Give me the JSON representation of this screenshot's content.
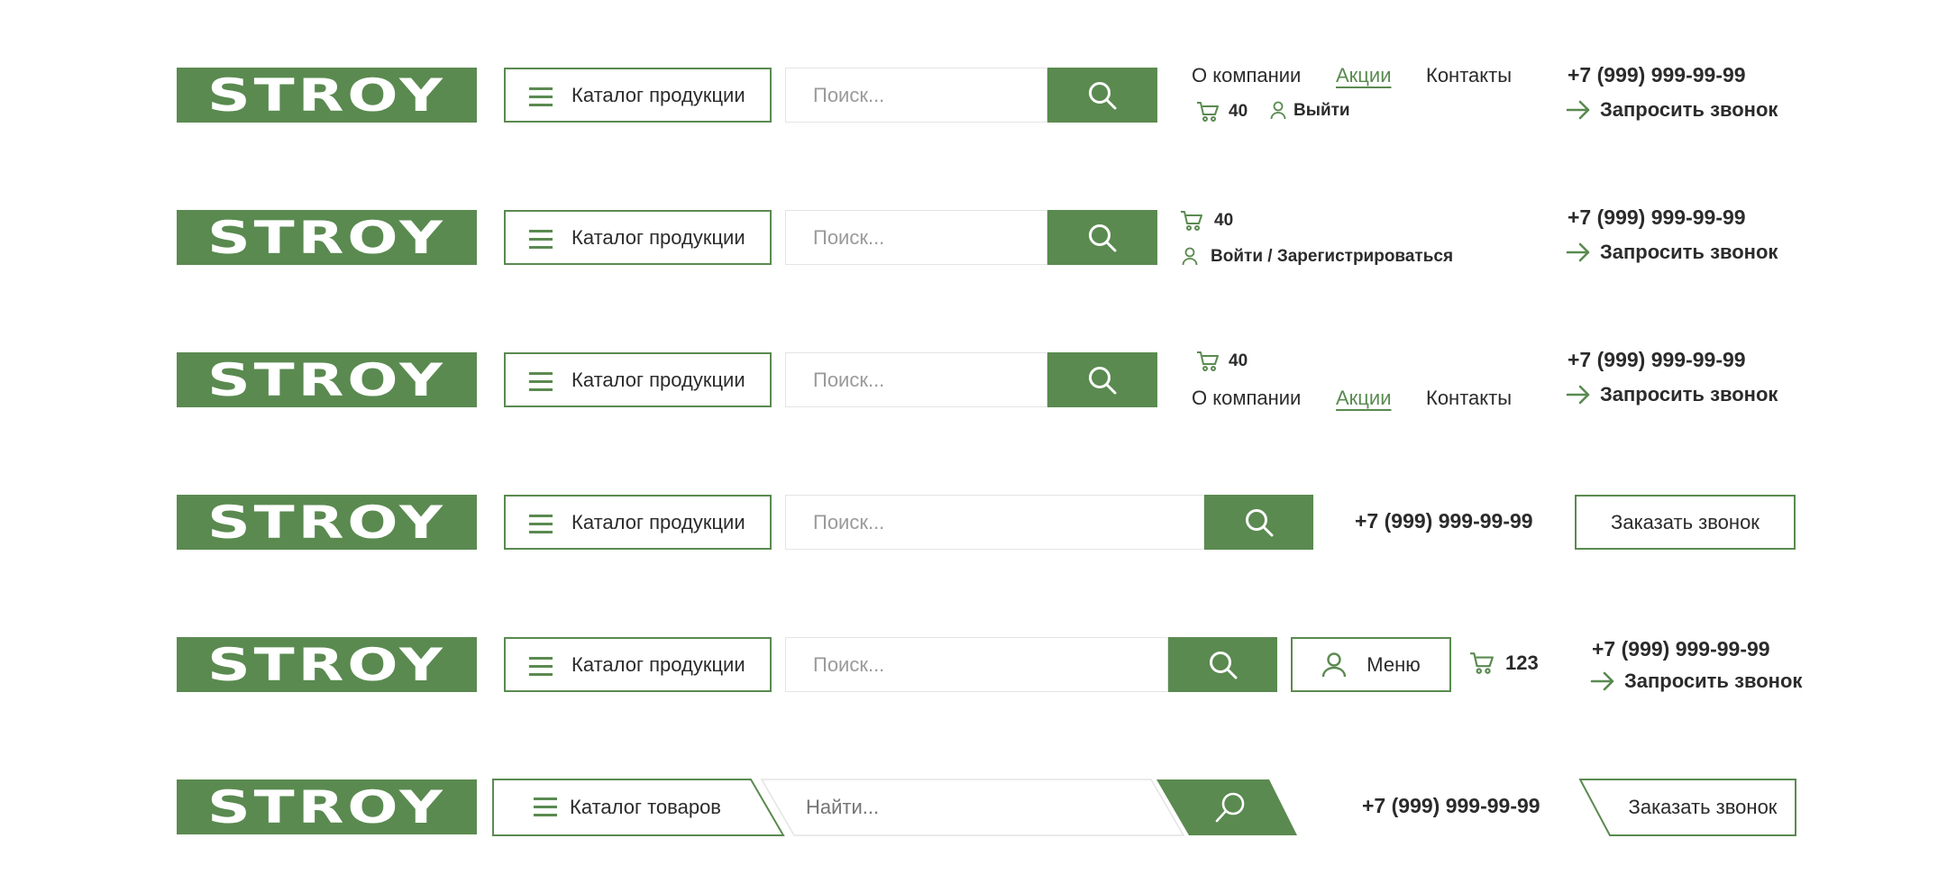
{
  "brand": {
    "logo_text": "STROY",
    "accent": "#5a8a50"
  },
  "rows": [
    {
      "catalog_label": "Каталог продукции",
      "search_placeholder": "Поиск...",
      "nav": [
        "О компании",
        "Акции",
        "Контакты"
      ],
      "cart_count": "40",
      "account_label": "Выйти",
      "phone": "+7 (999) 999-99-99",
      "callback_label": "Запросить звонок"
    },
    {
      "catalog_label": "Каталог продукции",
      "search_placeholder": "Поиск...",
      "cart_count": "40",
      "account_label": "Войти / Зарегистрироваться",
      "phone": "+7 (999) 999-99-99",
      "callback_label": "Запросить звонок"
    },
    {
      "catalog_label": "Каталог продукции",
      "search_placeholder": "Поиск...",
      "cart_count": "40",
      "nav": [
        "О компании",
        "Акции",
        "Контакты"
      ],
      "phone": "+7 (999) 999-99-99",
      "callback_label": "Запросить звонок"
    },
    {
      "catalog_label": "Каталог продукции",
      "search_placeholder": "Поиск...",
      "phone": "+7 (999) 999-99-99",
      "order_call_label": "Заказать звонок"
    },
    {
      "catalog_label": "Каталог продукции",
      "search_placeholder": "Поиск...",
      "menu_label": "Меню",
      "cart_count": "123",
      "phone": "+7 (999) 999-99-99",
      "callback_label": "Запросить звонок"
    },
    {
      "catalog_label": "Каталог товаров",
      "search_placeholder": "Найти...",
      "phone": "+7 (999) 999-99-99",
      "order_call_label": "Заказать звонок"
    }
  ],
  "icons": [
    "search-icon",
    "cart-icon",
    "user-icon",
    "arrow-right-icon",
    "burger-icon"
  ]
}
